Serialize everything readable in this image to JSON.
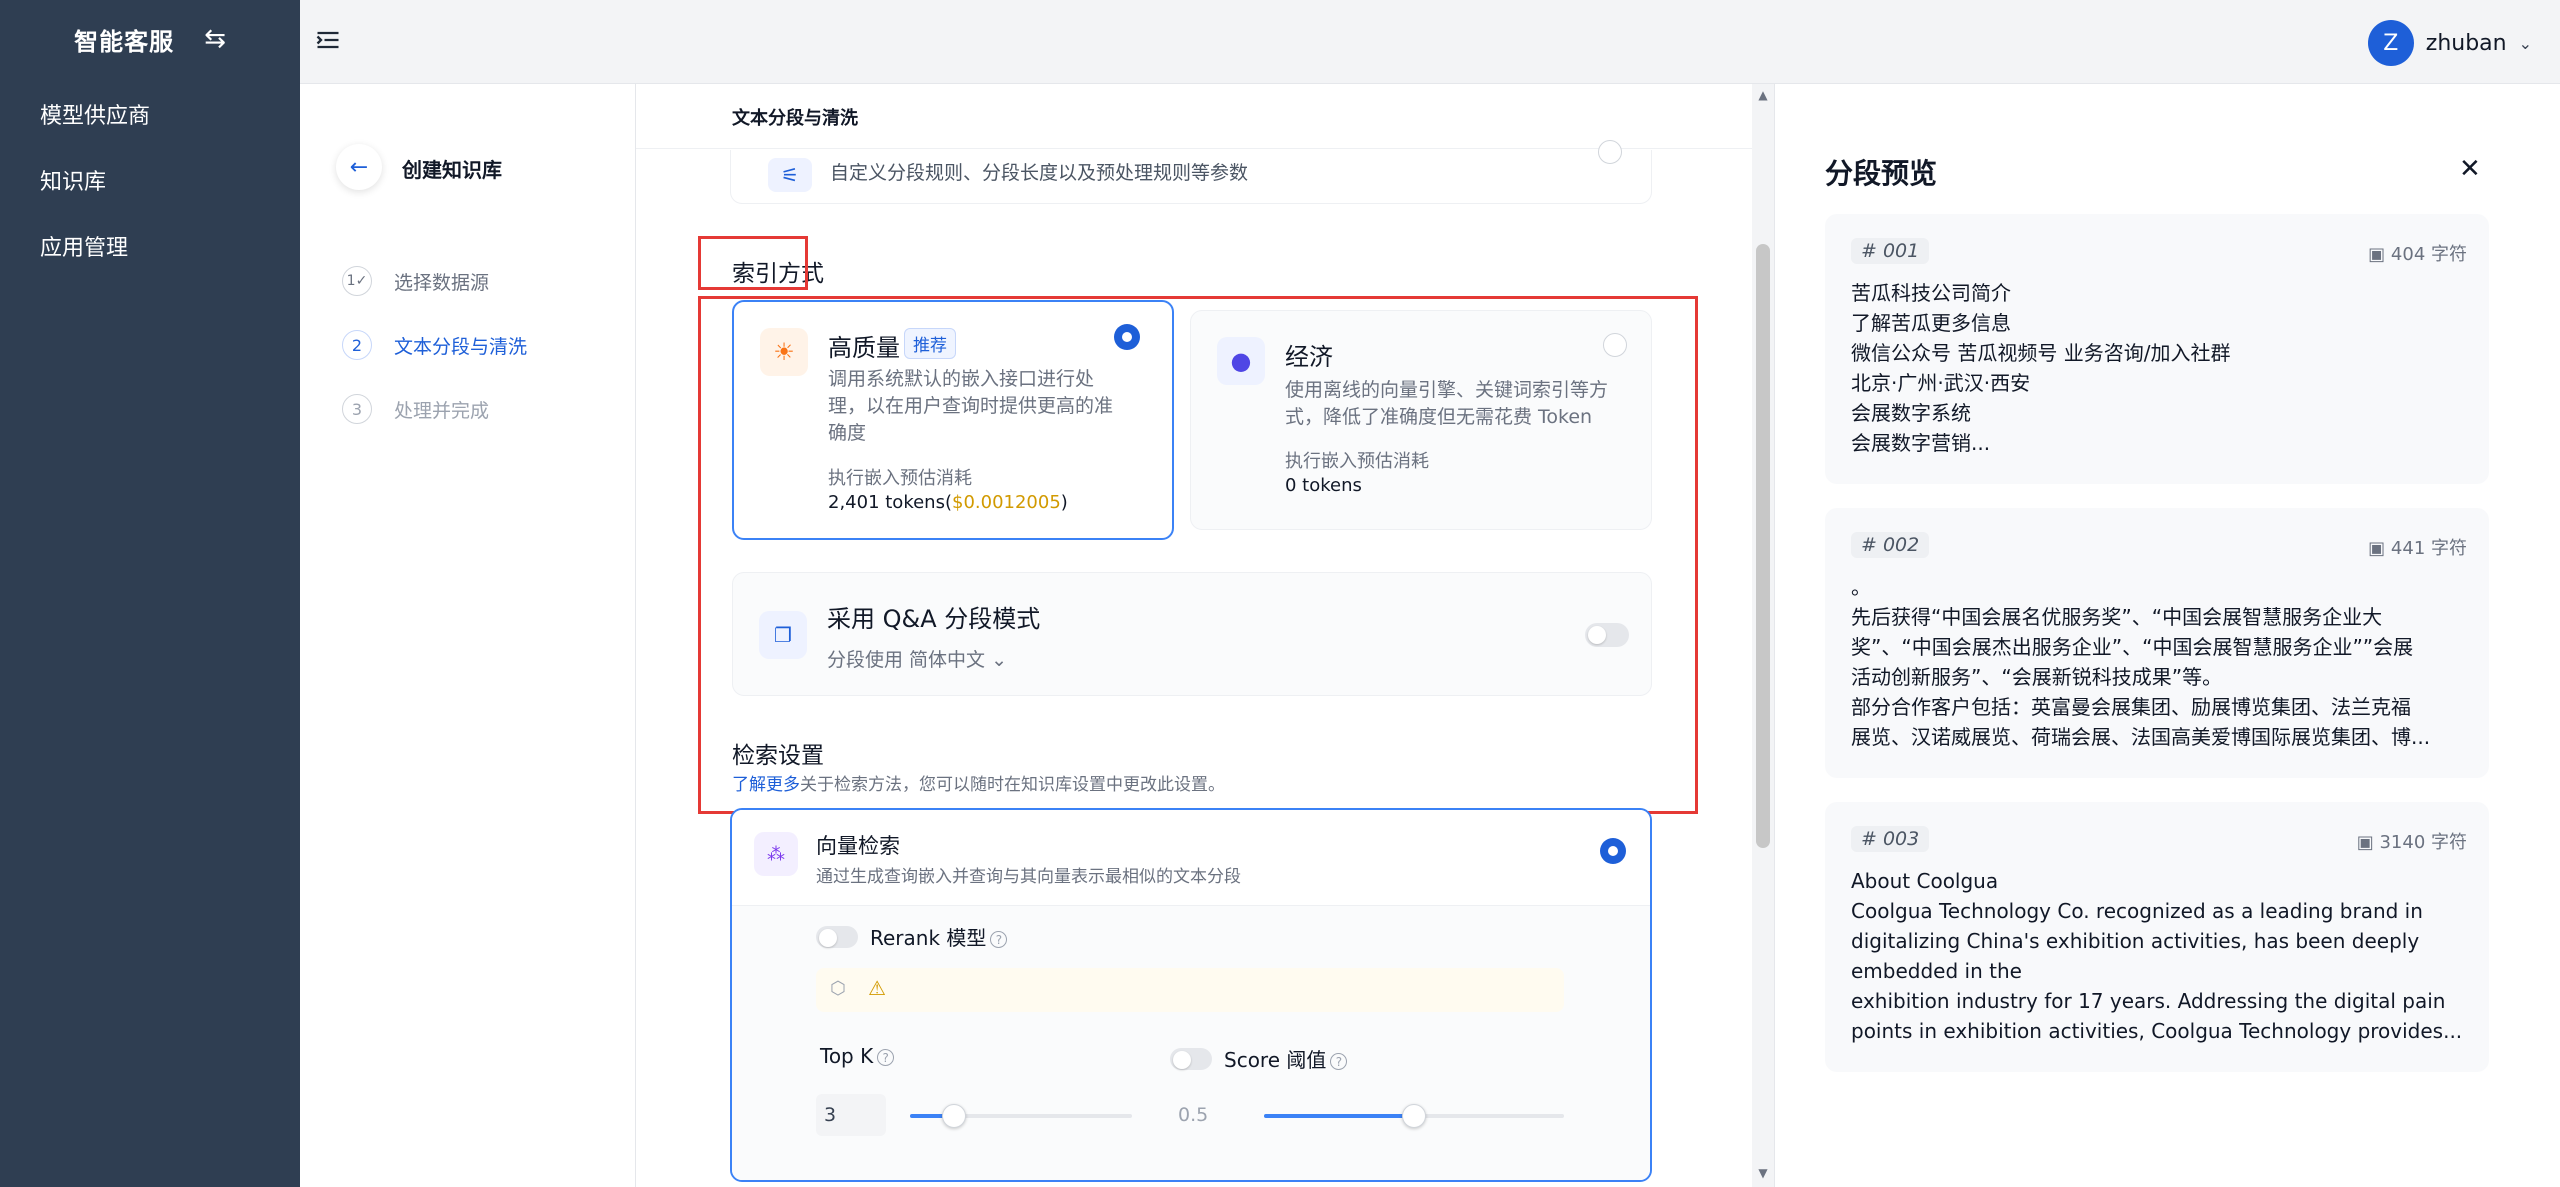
{
  "sidebar": {
    "brand_title": "智能客服",
    "brand_icon": "⇆",
    "items": [
      {
        "label": "模型供应商"
      },
      {
        "label": "知识库"
      },
      {
        "label": "应用管理"
      }
    ]
  },
  "header": {
    "avatar_letter": "Z",
    "username": "zhuban"
  },
  "steps": {
    "title": "创建知识库",
    "items": [
      {
        "num": "1✓",
        "label": "选择数据源"
      },
      {
        "num": "2",
        "label": "文本分段与清洗"
      },
      {
        "num": "3",
        "label": "处理并完成"
      }
    ]
  },
  "main": {
    "sticky_title": "文本分段与清洗",
    "custom_desc": "自定义分段规则、分段长度以及预处理规则等参数",
    "index_title": "索引方式",
    "high_quality": {
      "title": "高质量",
      "tag": "推荐",
      "desc_lines": [
        "调用系统默认的嵌入接口进行处",
        "理，以在用户查询时提供更高的准",
        "确度"
      ],
      "cost_label": "执行嵌入预估消耗",
      "cost_tokens": "2,401 tokens(",
      "cost_price": "$0.0012005",
      "cost_close": ")"
    },
    "economy": {
      "title": "经济",
      "desc_lines": [
        "使用离线的向量引擎、关键词索引等方",
        "式，降低了准确度但无需花费 Token"
      ],
      "cost_label": "执行嵌入预估消耗",
      "cost_tokens": "0 tokens"
    },
    "qa": {
      "title": "采用 Q&A 分段模式",
      "sub": "分段使用 简体中文"
    },
    "retrieval": {
      "title": "检索设置",
      "learn_more": "了解更多",
      "hint": "关于检索方法，您可以随时在知识库设置中更改此设置。",
      "vector_title": "向量检索",
      "vector_desc": "通过生成查询嵌入并查询与其向量表示最相似的文本分段",
      "rerank_label": "Rerank 模型",
      "topk_label": "Top K",
      "topk_value": "3",
      "topk_fraction": 0.2,
      "score_label": "Score 阈值",
      "score_value": "0.5",
      "score_fraction": 0.5
    }
  },
  "preview": {
    "title": "分段预览",
    "chunks": [
      {
        "id": "001",
        "count": "404 字符",
        "lines": [
          "苦瓜科技公司简介",
          "了解苦瓜更多信息",
          "微信公众号 苦瓜视频号 业务咨询/加入社群",
          "北京·广州·武汉·西安",
          "会展数字系统",
          "会展数字营销..."
        ]
      },
      {
        "id": "002",
        "count": "441 字符",
        "lines": [
          "。",
          "先后获得“中国会展名优服务奖”、“中国会展智慧服务企业大",
          "奖”、“中国会展杰出服务企业”、“中国会展智慧服务企业””会展",
          "活动创新服务”、“会展新锐科技成果”等。",
          "部分合作客户包括：英富曼会展集团、励展博览集团、法兰克福",
          "展览、汉诺威展览、荷瑞会展、法国高美爱博国际展览集团、博..."
        ]
      },
      {
        "id": "003",
        "count": "3140 字符",
        "lines": [
          "About Coolgua",
          "Coolgua Technology Co. recognized as a leading brand in",
          "digitalizing China's exhibition activities, has been deeply",
          "embedded in the",
          "exhibition industry for 17 years. Addressing the digital pain",
          "points in exhibition activities, Coolgua Technology provides..."
        ]
      }
    ]
  },
  "colors": {
    "sidebar_bg": "#2f3e52",
    "accent": "#1e5fd8",
    "highlight_box": "#e53935",
    "price": "#d29a00"
  }
}
